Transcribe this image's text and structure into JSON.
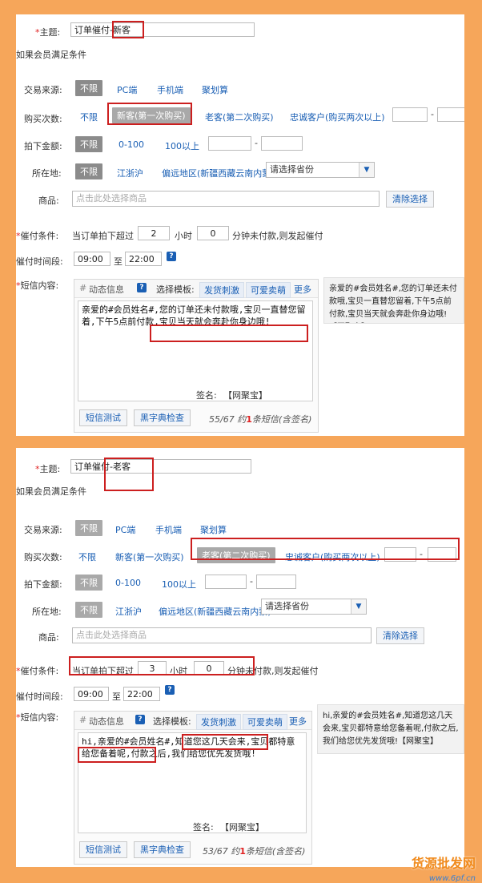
{
  "panels": [
    {
      "subject_label": "主题:",
      "subject_value": "订单催付-新客",
      "conditions_header": "如果会员满足条件",
      "source_label": "交易来源:",
      "source_opts": [
        "不限",
        "PC端",
        "手机端",
        "聚划算"
      ],
      "times_label": "购买次数:",
      "times_opts": [
        "不限",
        "新客(第一次购买)",
        "老客(第二次购买)",
        "忠诚客户(购买两次以上)"
      ],
      "amount_label": "拍下金额:",
      "amount_opts": [
        "不限",
        "0-100",
        "100以上"
      ],
      "location_label": "所在地:",
      "location_opts": [
        "不限",
        "江浙沪",
        "偏远地区(新疆西藏云南内蒙)"
      ],
      "province_select": "请选择省份",
      "goods_label": "商品:",
      "goods_placeholder": "点击此处选择商品",
      "clear_btn": "清除选择",
      "cond_label": "催付条件:",
      "cond_prefix": "当订单拍下超过",
      "cond_hours": "2",
      "cond_hours_unit": "小时",
      "cond_minutes": "0",
      "cond_suffix": "分钟未付款,则发起催付",
      "time_label": "催付时间段:",
      "time_from": "09:00",
      "time_to_label": "至",
      "time_to": "22:00",
      "sms_label": "短信内容:",
      "dyn_info": "动态信息",
      "tpl_label": "选择模板:",
      "tpl_opts": [
        "发货刺激",
        "可爱卖萌"
      ],
      "more": "更多",
      "sms_text": "亲爱的#会员姓名#,您的订单还未付款哦,宝贝一直替您留着,下午5点前付款,宝贝当天就会奔赴你身边哦!",
      "sign_label": "签名:",
      "sign_value": "网聚宝",
      "test_btn": "短信测试",
      "blackword_btn": "黑字典检查",
      "count_prefix": "55/67",
      "count_about": "约",
      "count_num": "1",
      "count_suffix": "条短信(含签名)",
      "preview_text": "亲爱的#会员姓名#,您的订单还未付款哦,宝贝一直替您留着,下午5点前付款,宝贝当天就会奔赴你身边哦!【网聚宝】"
    },
    {
      "subject_label": "主题:",
      "subject_value": "订单催付-老客",
      "conditions_header": "如果会员满足条件",
      "source_label": "交易来源:",
      "source_opts": [
        "不限",
        "PC端",
        "手机端",
        "聚划算"
      ],
      "times_label": "购买次数:",
      "times_opts": [
        "不限",
        "新客(第一次购买)",
        "老客(第二次购买)",
        "忠诚客户(购买两次以上)"
      ],
      "amount_label": "拍下金额:",
      "amount_opts": [
        "不限",
        "0-100",
        "100以上"
      ],
      "location_label": "所在地:",
      "location_opts": [
        "不限",
        "江浙沪",
        "偏远地区(新疆西藏云南内蒙)"
      ],
      "province_select": "请选择省份",
      "goods_label": "商品:",
      "goods_placeholder": "点击此处选择商品",
      "clear_btn": "清除选择",
      "cond_label": "催付条件:",
      "cond_prefix": "当订单拍下超过",
      "cond_hours": "3",
      "cond_hours_unit": "小时",
      "cond_minutes": "0",
      "cond_suffix": "分钟未付款,则发起催付",
      "time_label": "催付时间段:",
      "time_from": "09:00",
      "time_to_label": "至",
      "time_to": "22:00",
      "sms_label": "短信内容:",
      "dyn_info": "动态信息",
      "tpl_label": "选择模板:",
      "tpl_opts": [
        "发货刺激",
        "可爱卖萌"
      ],
      "more": "更多",
      "sms_text": "hi,亲爱的#会员姓名#,知道您这几天会来,宝贝都特意给您备着呢,付款之后,我们给您优先发货哦!",
      "sign_label": "签名:",
      "sign_value": "网聚宝",
      "test_btn": "短信测试",
      "blackword_btn": "黑字典检查",
      "count_prefix": "53/67",
      "count_about": "约",
      "count_num": "1",
      "count_suffix": "条短信(含签名)",
      "preview_text": "hi,亲爱的#会员姓名#,知道您这几天会来,宝贝都特意给您备着呢,付款之后,我们给您优先发货哦!【网聚宝】"
    }
  ],
  "watermark": {
    "brand": "货源批发网",
    "url": "www.6pf.cn"
  }
}
